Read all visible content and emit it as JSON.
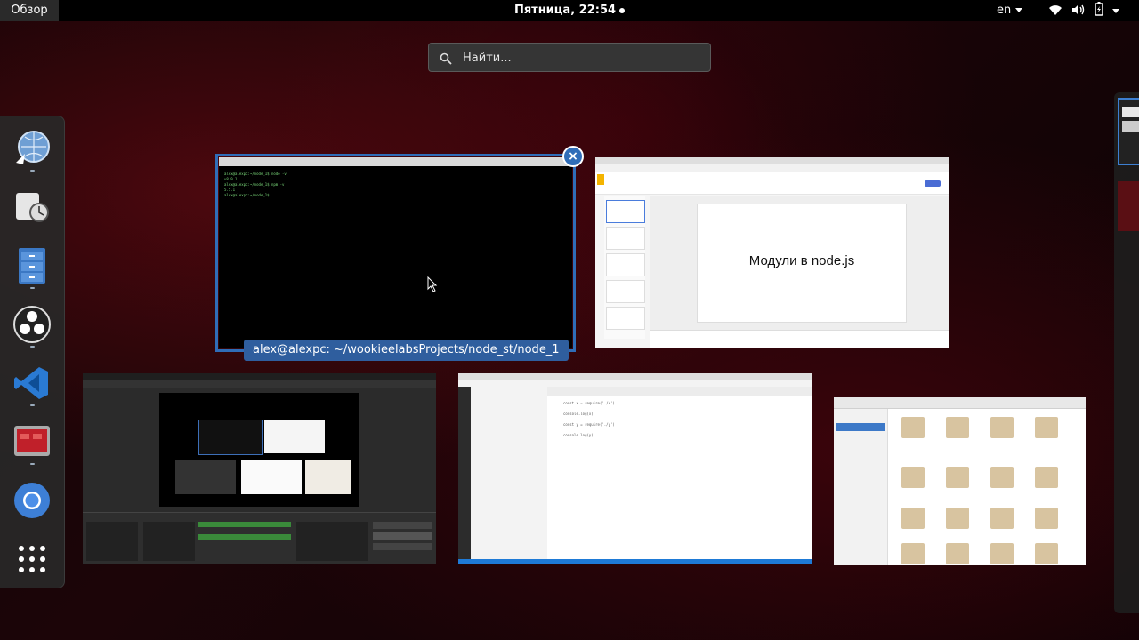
{
  "topbar": {
    "activities_label": "Обзор",
    "clock": "Пятница, 22:54",
    "language": "en"
  },
  "search": {
    "placeholder": "Найти..."
  },
  "dash": {
    "apps": [
      "web-browser",
      "clock-app",
      "file-manager",
      "obs-studio",
      "vscode",
      "screen-recorder",
      "chromium",
      "show-applications"
    ]
  },
  "windows": {
    "terminal": {
      "caption": "alex@alexpc: ~/wookieelabsProjects/node_st/node_1",
      "lines": [
        "alex@alexpc:~/node_1$ node -v",
        "v8.9.1",
        "alex@alexpc:~/node_1$ npm -v",
        "5.5.1",
        "alex@alexpc:~/node_1$"
      ]
    },
    "slides": {
      "slide_title": "Модули в node.js"
    },
    "editor": {
      "code": [
        "const x = require('./x')",
        "console.log(x)",
        "",
        "const y = require('./y')",
        "",
        "console.log(y)"
      ]
    }
  },
  "colors": {
    "accent": "#2f6db8",
    "panel": "#2a2a2a"
  }
}
